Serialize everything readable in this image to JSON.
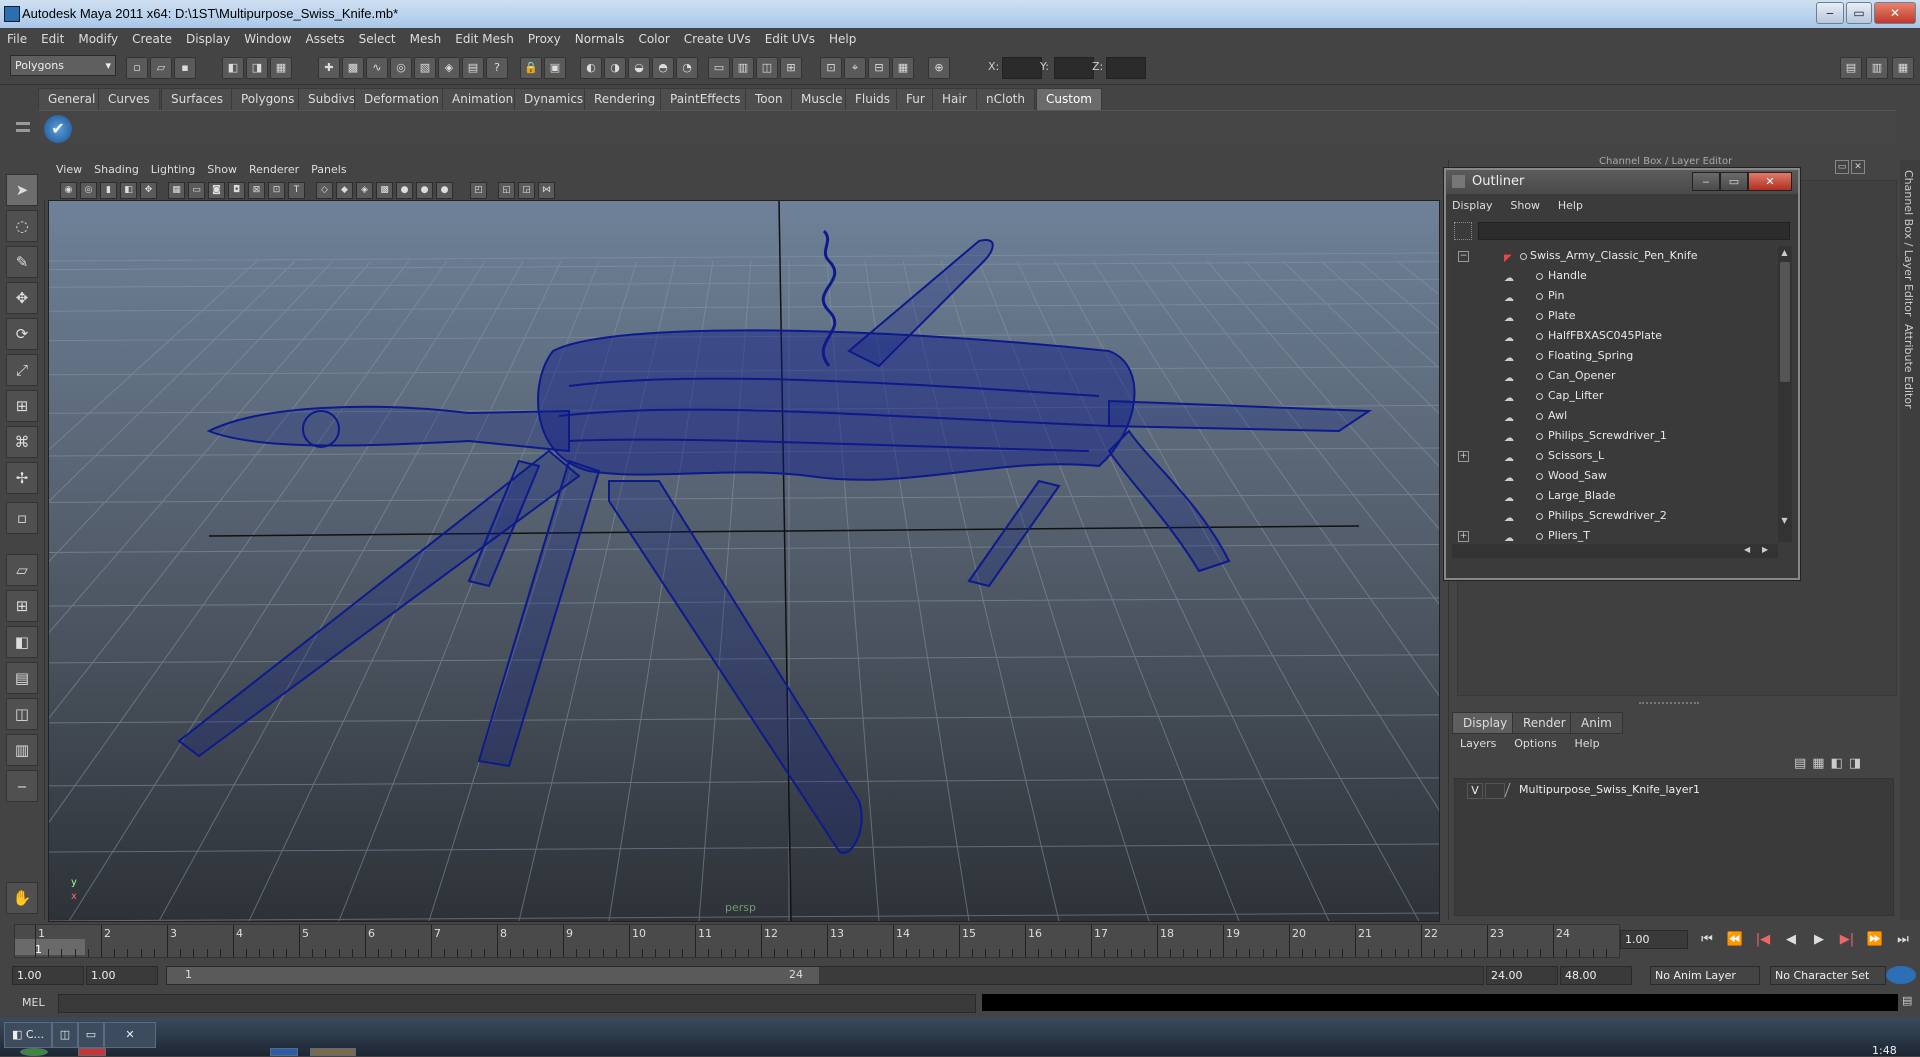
{
  "window": {
    "title": "Autodesk Maya 2011 x64: D:\\1ST\\Multipurpose_Swiss_Knife.mb*",
    "min": "‒",
    "max": "▭",
    "close": "✕"
  },
  "menu": [
    "File",
    "Edit",
    "Modify",
    "Create",
    "Display",
    "Window",
    "Assets",
    "Select",
    "Mesh",
    "Edit Mesh",
    "Proxy",
    "Normals",
    "Color",
    "Create UVs",
    "Edit UVs",
    "Help"
  ],
  "status": {
    "mode": "Polygons",
    "x_label": "X:",
    "y_label": "Y:",
    "z_label": "Z:"
  },
  "shelf_tabs": [
    "General",
    "Curves",
    "Surfaces",
    "Polygons",
    "Subdivs",
    "Deformation",
    "Animation",
    "Dynamics",
    "Rendering",
    "PaintEffects",
    "Toon",
    "Muscle",
    "Fluids",
    "Fur",
    "Hair",
    "nCloth",
    "Custom"
  ],
  "shelf_active": "Custom",
  "viewport": {
    "menu": [
      "View",
      "Shading",
      "Lighting",
      "Show",
      "Renderer",
      "Panels"
    ],
    "camera": "persp",
    "axis_y": "y",
    "axis_x": "x"
  },
  "right_panel_title": "Channel Box / Layer Editor",
  "side_tabs": [
    "Channel Box / Layer Editor",
    "Attribute Editor"
  ],
  "outliner": {
    "title": "Outliner",
    "menu": [
      "Display",
      "Show",
      "Help"
    ],
    "root": "Swiss_Army_Classic_Pen_Knife",
    "items": [
      {
        "label": "Handle",
        "expandable": false
      },
      {
        "label": "Pin",
        "expandable": false
      },
      {
        "label": "Plate",
        "expandable": false
      },
      {
        "label": "HalfFBXASC045Plate",
        "expandable": false
      },
      {
        "label": "Floating_Spring",
        "expandable": false
      },
      {
        "label": "Can_Opener",
        "expandable": false
      },
      {
        "label": "Cap_Lifter",
        "expandable": false
      },
      {
        "label": "Awl",
        "expandable": false
      },
      {
        "label": "Philips_Screwdriver_1",
        "expandable": false
      },
      {
        "label": "Scissors_L",
        "expandable": true
      },
      {
        "label": "Wood_Saw",
        "expandable": false
      },
      {
        "label": "Large_Blade",
        "expandable": false
      },
      {
        "label": "Philips_Screwdriver_2",
        "expandable": false
      },
      {
        "label": "Pliers_T",
        "expandable": true
      }
    ]
  },
  "layer_editor": {
    "tabs": [
      "Display",
      "Render",
      "Anim"
    ],
    "menu": [
      "Layers",
      "Options",
      "Help"
    ],
    "layers": [
      {
        "visible": "V",
        "name": "Multipurpose_Swiss_Knife_layer1"
      }
    ]
  },
  "timeline": {
    "ticks": [
      "1",
      "2",
      "3",
      "4",
      "5",
      "6",
      "7",
      "8",
      "9",
      "10",
      "11",
      "12",
      "13",
      "14",
      "15",
      "16",
      "17",
      "18",
      "19",
      "20",
      "21",
      "22",
      "23",
      "24"
    ],
    "current_frame": "1",
    "current_field": "1.00"
  },
  "range": {
    "start": "1.00",
    "playback_start": "1.00",
    "slider_start": "1",
    "slider_end": "24",
    "playback_end": "24.00",
    "end": "48.00",
    "anim_layer": "No Anim Layer",
    "char_set": "No Character Set"
  },
  "mel_label": "MEL",
  "taskbar": {
    "clock": "1:48"
  }
}
